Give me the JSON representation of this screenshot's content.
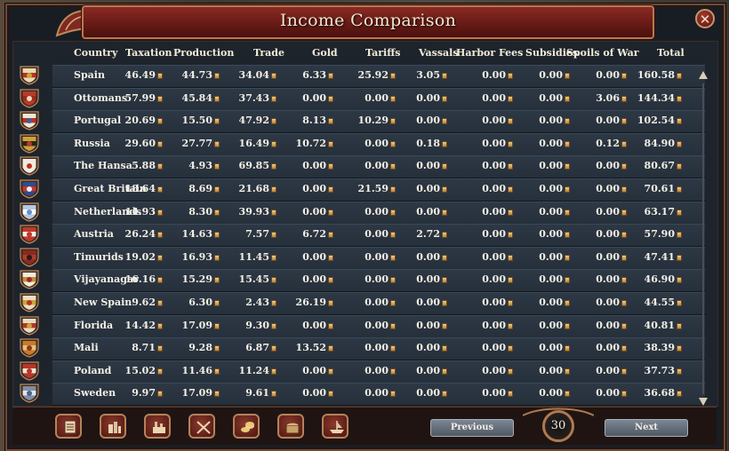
{
  "window": {
    "title": "Income Comparison"
  },
  "columns": [
    "Country",
    "Taxation",
    "Production",
    "Trade",
    "Gold",
    "Tariffs",
    "Vassals",
    "Harbor Fees",
    "Subsidies",
    "Spoils of War",
    "Total"
  ],
  "rows": [
    {
      "country": "Spain",
      "taxation": "46.49",
      "production": "44.73",
      "trade": "34.04",
      "gold": "6.33",
      "tariffs": "25.92",
      "vassals": "3.05",
      "harbor": "0.00",
      "subsidies": "0.00",
      "spoils": "0.00",
      "total": "160.58",
      "flag": [
        "#e8d9b0",
        "#b5341f",
        "#c9a43a"
      ]
    },
    {
      "country": "Ottomans",
      "taxation": "57.99",
      "production": "45.84",
      "trade": "37.43",
      "gold": "0.00",
      "tariffs": "0.00",
      "vassals": "0.00",
      "harbor": "0.00",
      "subsidies": "0.00",
      "spoils": "3.06",
      "total": "144.34",
      "flag": [
        "#b73a2a",
        "#9c2a1e",
        "#e9dcc0"
      ]
    },
    {
      "country": "Portugal",
      "taxation": "20.69",
      "production": "15.50",
      "trade": "47.92",
      "gold": "8.13",
      "tariffs": "10.29",
      "vassals": "0.00",
      "harbor": "0.00",
      "subsidies": "0.00",
      "spoils": "0.00",
      "total": "102.54",
      "flag": [
        "#f0e7d2",
        "#b8331f",
        "#3b5da6"
      ]
    },
    {
      "country": "Russia",
      "taxation": "29.60",
      "production": "27.77",
      "trade": "16.49",
      "gold": "10.72",
      "tariffs": "0.00",
      "vassals": "0.18",
      "harbor": "0.00",
      "subsidies": "0.00",
      "spoils": "0.12",
      "total": "84.90",
      "flag": [
        "#c9a43a",
        "#2a241c",
        "#b73a2a"
      ]
    },
    {
      "country": "The Hansa",
      "taxation": "5.88",
      "production": "4.93",
      "trade": "69.85",
      "gold": "0.00",
      "tariffs": "0.00",
      "vassals": "0.00",
      "harbor": "0.00",
      "subsidies": "0.00",
      "spoils": "0.00",
      "total": "80.67",
      "flag": [
        "#f1ebe0",
        "#f1ebe0",
        "#b8331f"
      ]
    },
    {
      "country": "Great Britain",
      "taxation": "18.64",
      "production": "8.69",
      "trade": "21.68",
      "gold": "0.00",
      "tariffs": "21.59",
      "vassals": "0.00",
      "harbor": "0.00",
      "subsidies": "0.00",
      "spoils": "0.00",
      "total": "70.61",
      "flag": [
        "#2f4b8f",
        "#c9352a",
        "#eeeeee"
      ]
    },
    {
      "country": "Netherlands",
      "taxation": "14.93",
      "production": "8.30",
      "trade": "39.93",
      "gold": "0.00",
      "tariffs": "0.00",
      "vassals": "0.00",
      "harbor": "0.00",
      "subsidies": "0.00",
      "spoils": "0.00",
      "total": "63.17",
      "flag": [
        "#b4c9e6",
        "#ffffff",
        "#6d8fc2"
      ]
    },
    {
      "country": "Austria",
      "taxation": "26.24",
      "production": "14.63",
      "trade": "7.57",
      "gold": "6.72",
      "tariffs": "0.00",
      "vassals": "2.72",
      "harbor": "0.00",
      "subsidies": "0.00",
      "spoils": "0.00",
      "total": "57.90",
      "flag": [
        "#c0392b",
        "#f2efe9",
        "#c0392b"
      ]
    },
    {
      "country": "Timurids",
      "taxation": "19.02",
      "production": "16.93",
      "trade": "11.45",
      "gold": "0.00",
      "tariffs": "0.00",
      "vassals": "0.00",
      "harbor": "0.00",
      "subsidies": "0.00",
      "spoils": "0.00",
      "total": "47.41",
      "flag": [
        "#8a2a22",
        "#b03a2e",
        "#2a1a16"
      ]
    },
    {
      "country": "Vijayanagar",
      "taxation": "16.16",
      "production": "15.29",
      "trade": "15.45",
      "gold": "0.00",
      "tariffs": "0.00",
      "vassals": "0.00",
      "harbor": "0.00",
      "subsidies": "0.00",
      "spoils": "0.00",
      "total": "46.90",
      "flag": [
        "#f2ead9",
        "#c68a3a",
        "#9a2b20"
      ]
    },
    {
      "country": "New Spain",
      "taxation": "9.62",
      "production": "6.30",
      "trade": "2.43",
      "gold": "26.19",
      "tariffs": "0.00",
      "vassals": "0.00",
      "harbor": "0.00",
      "subsidies": "0.00",
      "spoils": "0.00",
      "total": "44.55",
      "flag": [
        "#e9dec2",
        "#c9a43a",
        "#b5341f"
      ]
    },
    {
      "country": "Florida",
      "taxation": "14.42",
      "production": "17.09",
      "trade": "9.30",
      "gold": "0.00",
      "tariffs": "0.00",
      "vassals": "0.00",
      "harbor": "0.00",
      "subsidies": "0.00",
      "spoils": "0.00",
      "total": "40.81",
      "flag": [
        "#e6dcc6",
        "#b5341f",
        "#c9a43a"
      ]
    },
    {
      "country": "Mali",
      "taxation": "8.71",
      "production": "9.28",
      "trade": "6.87",
      "gold": "13.52",
      "tariffs": "0.00",
      "vassals": "0.00",
      "harbor": "0.00",
      "subsidies": "0.00",
      "spoils": "0.00",
      "total": "38.39",
      "flag": [
        "#c87a2a",
        "#e4c07a",
        "#8a3a1a"
      ]
    },
    {
      "country": "Poland",
      "taxation": "15.02",
      "production": "11.46",
      "trade": "11.24",
      "gold": "0.00",
      "tariffs": "0.00",
      "vassals": "0.00",
      "harbor": "0.00",
      "subsidies": "0.00",
      "spoils": "0.00",
      "total": "37.73",
      "flag": [
        "#b8352a",
        "#efe6d4",
        "#b8352a"
      ]
    },
    {
      "country": "Sweden",
      "taxation": "9.97",
      "production": "17.09",
      "trade": "9.61",
      "gold": "0.00",
      "tariffs": "0.00",
      "vassals": "0.00",
      "harbor": "0.00",
      "subsidies": "0.00",
      "spoils": "0.00",
      "total": "36.68",
      "flag": [
        "#7f8fa6",
        "#dfe6ee",
        "#4e6382"
      ]
    }
  ],
  "footer": {
    "toolbar_icons": [
      "ledger-icon",
      "buildings-icon",
      "factory-icon",
      "crossed-swords-icon",
      "coins-icon",
      "chest-icon",
      "ship-icon"
    ],
    "previous_label": "Previous",
    "next_label": "Next",
    "page_number": "30"
  },
  "colors": {
    "title_bar": "#7a221c",
    "row_bg": "#2b3541",
    "frame": "#b57a4e"
  }
}
